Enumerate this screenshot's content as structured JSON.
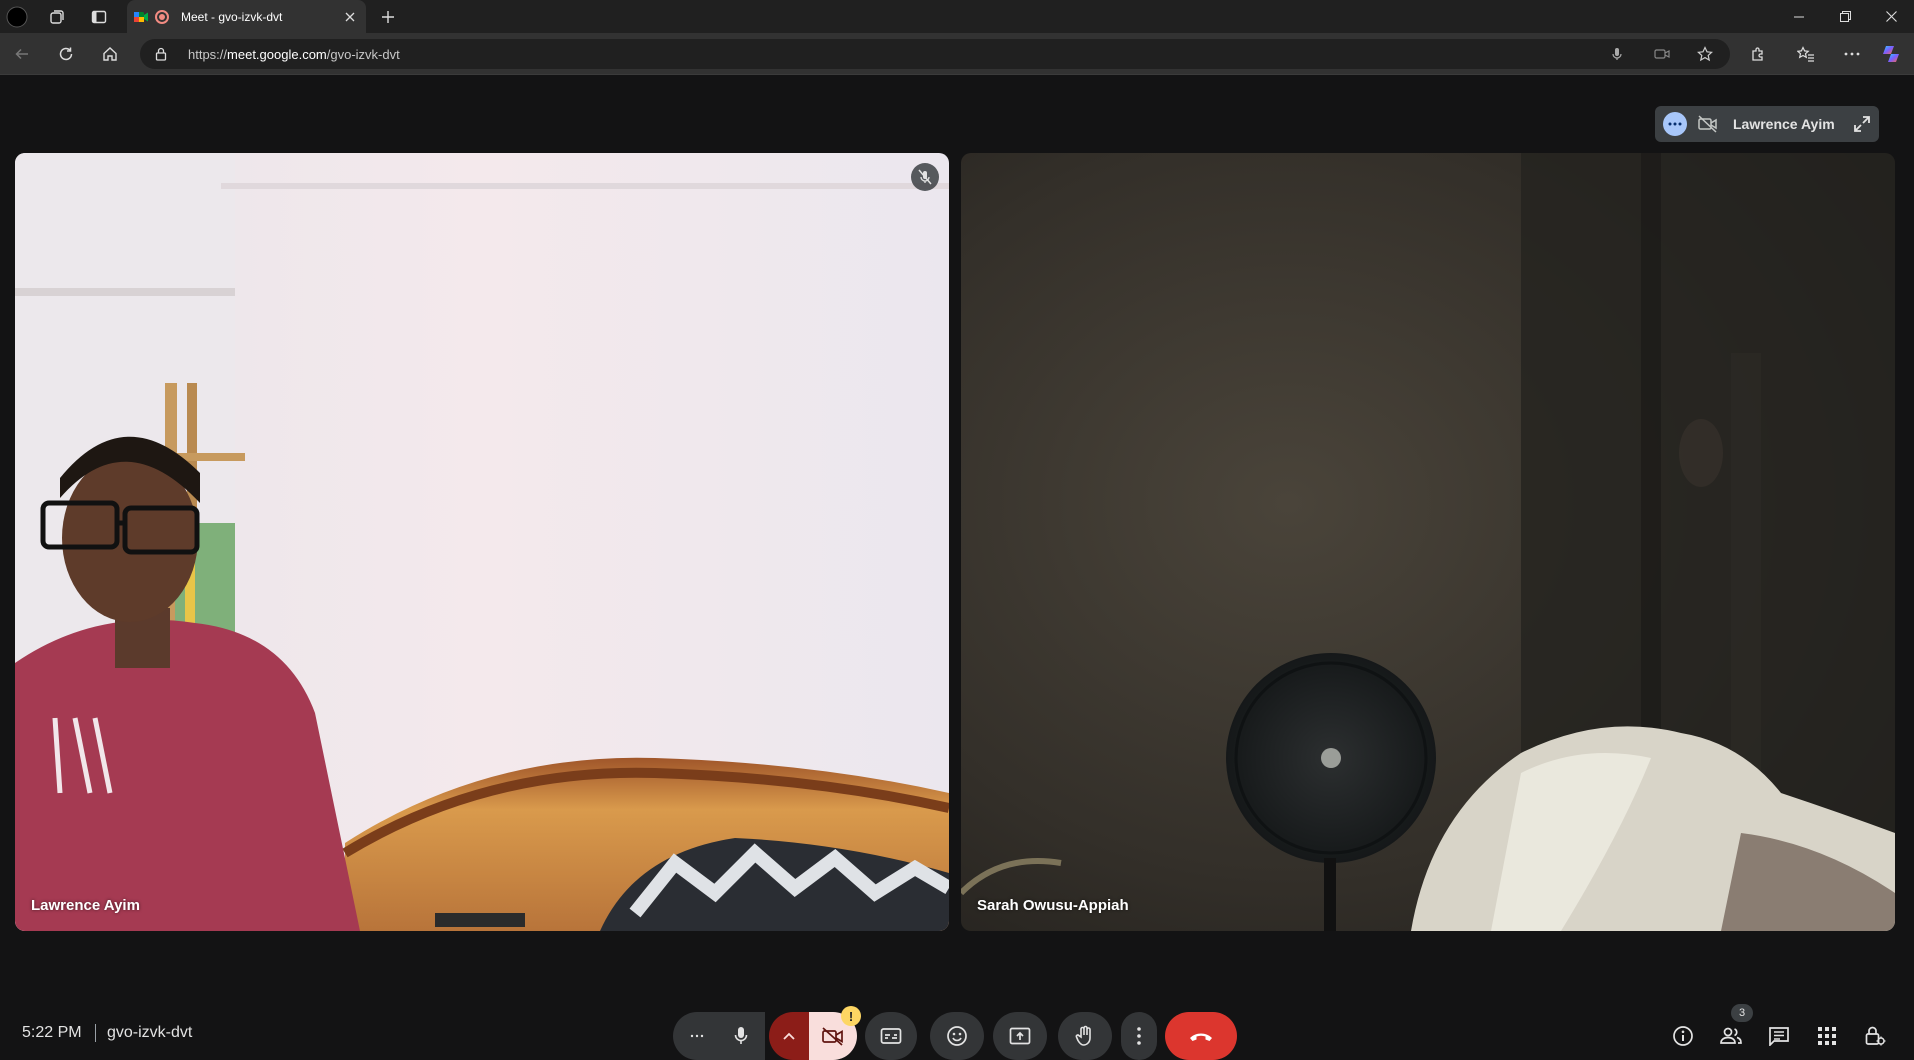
{
  "browser": {
    "tab_title": "Meet - gvo-izvk-dvt",
    "url_prefix": "https://",
    "url_host": "meet.google.com",
    "url_path": "/gvo-izvk-dvt"
  },
  "meet": {
    "pinned_chip": {
      "name": "Lawrence Ayim"
    },
    "tiles": [
      {
        "name": "Lawrence Ayim",
        "muted": true
      },
      {
        "name": "Sarah Owusu-Appiah",
        "muted": false
      }
    ],
    "bottom": {
      "time": "5:22 PM",
      "meeting_code": "gvo-izvk-dvt",
      "people_count": "3",
      "camera_warning": "!"
    }
  },
  "colors": {
    "background": "#131314",
    "end_call": "#dc362e",
    "control": "#333537",
    "accent": "#a8c7fa"
  },
  "icons": [
    "copilot-icon",
    "workspaces-icon",
    "vertical-tabs-icon",
    "meet-favicon",
    "recording-icon",
    "mic-icon",
    "camera-off-icon",
    "captions-icon",
    "emoji-icon",
    "present-icon",
    "raise-hand-icon",
    "more-vert-icon",
    "end-call-icon",
    "info-icon",
    "people-icon",
    "chat-icon",
    "apps-icon",
    "host-controls-icon"
  ]
}
